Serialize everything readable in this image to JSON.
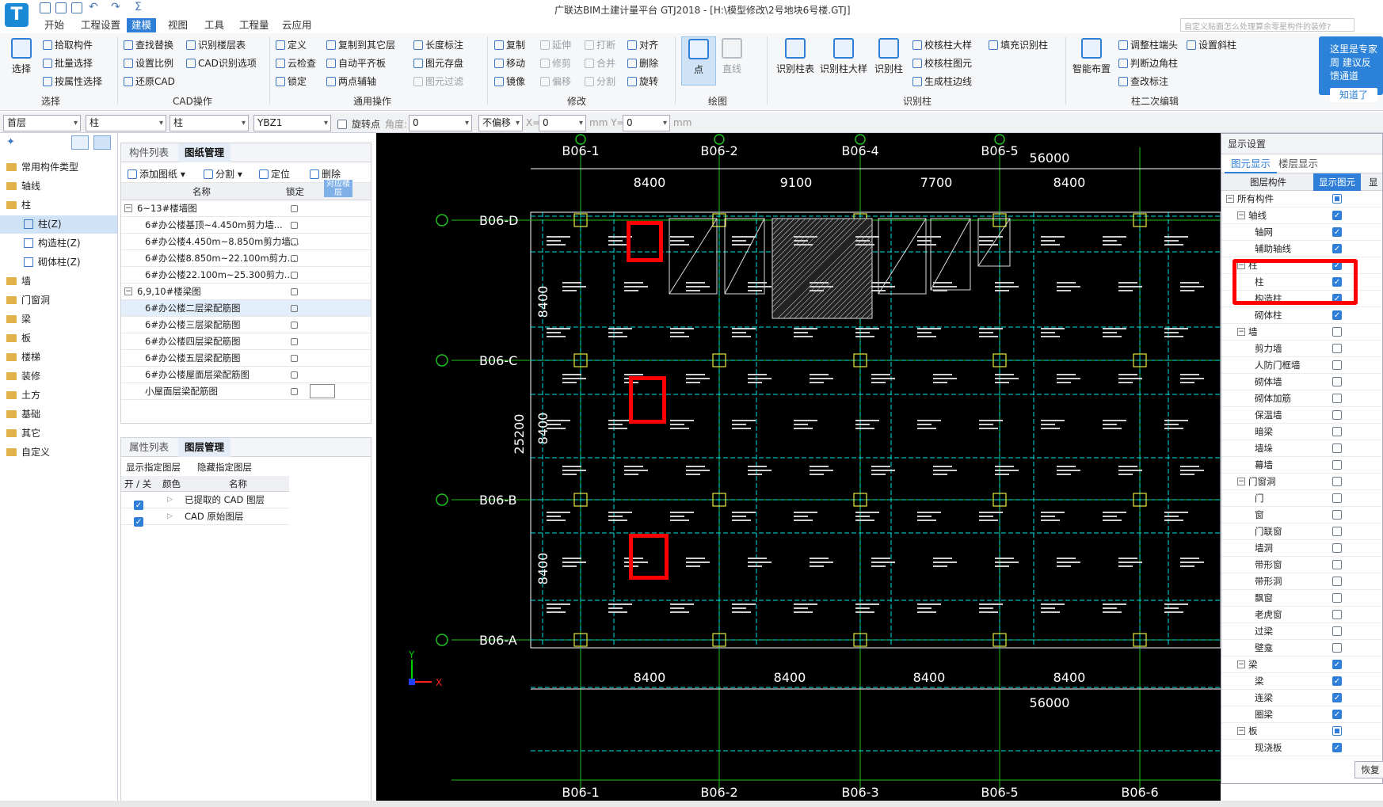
{
  "app": {
    "title": "广联达BIM土建计量平台 GTJ2018 - [H:\\模型修改\\2号地块6号楼.GTJ]",
    "logo": "T"
  },
  "menus": [
    "开始",
    "工程设置",
    "建模",
    "视图",
    "工具",
    "工程量",
    "云应用"
  ],
  "active_menu": "建模",
  "search_placeholder": "自定义贴面怎么处理算余零星构件的装修?",
  "ribbon": {
    "select": {
      "big": "选择",
      "items": [
        "拾取构件",
        "批量选择",
        "按属性选择"
      ],
      "group": "选择"
    },
    "cad": {
      "items": [
        "查找替换",
        "识别楼层表",
        "设置比例",
        "CAD识别选项",
        "还原CAD"
      ],
      "group": "CAD操作"
    },
    "general": {
      "items": [
        "定义",
        "复制到其它层",
        "长度标注",
        "云检查",
        "自动平齐板",
        "图元存盘",
        "锁定",
        "两点辅轴",
        "图元过滤"
      ],
      "group": "通用操作"
    },
    "modify": {
      "items": [
        "复制",
        "延伸",
        "打断",
        "对齐",
        "移动",
        "修剪",
        "合并",
        "删除",
        "镜像",
        "偏移",
        "分割",
        "旋转"
      ],
      "group": "修改"
    },
    "draw": {
      "big": "点",
      "line": "直线",
      "group": "绘图"
    },
    "recog": {
      "bigs": [
        "识别柱表",
        "识别柱大样",
        "识别柱"
      ],
      "items": [
        "校核柱大样",
        "填充识别柱",
        "校核柱图元",
        "生成柱边线"
      ],
      "group": "识别柱"
    },
    "edit2": {
      "big": "智能布置",
      "items": [
        "调整柱端头",
        "设置斜柱",
        "判断边角柱",
        "查改标注"
      ],
      "group": "柱二次编辑"
    }
  },
  "tip": {
    "text": "这里是专家周 建议反馈通道",
    "button": "知道了"
  },
  "propbar": {
    "floor": "首层",
    "type1": "柱",
    "type2": "柱",
    "name": "YBZ1",
    "rotate_label": "旋转点",
    "angle_label": "角度:",
    "angle": "0",
    "offset": "不偏移",
    "x_label": "X=",
    "x": "0",
    "y_label": "mm Y=",
    "y": "0",
    "unit": "mm"
  },
  "nav": [
    "常用构件类型",
    "轴线",
    "柱",
    "柱(Z)",
    "构造柱(Z)",
    "砌体柱(Z)",
    "墙",
    "门窗洞",
    "梁",
    "板",
    "楼梯",
    "装修",
    "土方",
    "基础",
    "其它",
    "自定义"
  ],
  "complist": {
    "tabs": [
      "构件列表",
      "图纸管理"
    ],
    "toolbar": [
      "添加图纸",
      "分割",
      "定位",
      "删除"
    ],
    "cols": [
      "名称",
      "锁定",
      "对应楼层"
    ],
    "rows": [
      "6~13#楼墙图",
      "6#办公楼基顶~4.450m剪力墙...",
      "6#办公楼4.450m~8.850m剪力墙...",
      "6#办公楼8.850m~22.100m剪力...",
      "6#办公楼22.100m~25.300剪力...",
      "6,9,10#楼梁图",
      "6#办公楼二层梁配筋图",
      "6#办公楼三层梁配筋图",
      "6#办公楼四层梁配筋图",
      "6#办公楼五层梁配筋图",
      "6#办公楼屋面层梁配筋图",
      "小屋面层梁配筋图"
    ]
  },
  "layermgr": {
    "tabs": [
      "属性列表",
      "图层管理"
    ],
    "actions": [
      "显示指定图层",
      "隐藏指定图层"
    ],
    "cols": [
      "开 / 关",
      "颜色",
      "名称"
    ],
    "rows": [
      "已提取的 CAD 图层",
      "CAD 原始图层"
    ]
  },
  "canvas": {
    "top_axes": [
      "B06-1",
      "B06-2",
      "B06-4",
      "B06-5"
    ],
    "bottom_axes": [
      "B06-1",
      "B06-2",
      "B06-3",
      "B06-5",
      "B06-6"
    ],
    "left_axes": [
      "B06-D",
      "B06-C",
      "B06-B",
      "B06-A"
    ],
    "top_dims": [
      "8400",
      "9100",
      "7700",
      "8400"
    ],
    "bottom_dims": [
      "8400",
      "8400",
      "8400",
      "8400"
    ],
    "overall": "56000",
    "vdims": [
      "8400",
      "8400",
      "8400"
    ],
    "vtotal": "25200",
    "x_label": "X",
    "y_label": "Y"
  },
  "display": {
    "title": "显示设置",
    "tabs": [
      "图元显示",
      "楼层显示"
    ],
    "cols": [
      "图层构件",
      "显示图元",
      "显"
    ],
    "rows": [
      [
        "所有构件",
        0,
        "partial"
      ],
      [
        "轴线",
        1,
        "on"
      ],
      [
        "轴网",
        2,
        "on"
      ],
      [
        "辅助轴线",
        2,
        "on"
      ],
      [
        "柱",
        1,
        "on"
      ],
      [
        "柱",
        2,
        "on"
      ],
      [
        "构造柱",
        2,
        "on"
      ],
      [
        "砌体柱",
        2,
        "on"
      ],
      [
        "墙",
        1,
        "off"
      ],
      [
        "剪力墙",
        2,
        "off"
      ],
      [
        "人防门框墙",
        2,
        "off"
      ],
      [
        "砌体墙",
        2,
        "off"
      ],
      [
        "砌体加筋",
        2,
        "off"
      ],
      [
        "保温墙",
        2,
        "off"
      ],
      [
        "暗梁",
        2,
        "off"
      ],
      [
        "墙垛",
        2,
        "off"
      ],
      [
        "幕墙",
        2,
        "off"
      ],
      [
        "门窗洞",
        1,
        "off"
      ],
      [
        "门",
        2,
        "off"
      ],
      [
        "窗",
        2,
        "off"
      ],
      [
        "门联窗",
        2,
        "off"
      ],
      [
        "墙洞",
        2,
        "off"
      ],
      [
        "带形窗",
        2,
        "off"
      ],
      [
        "带形洞",
        2,
        "off"
      ],
      [
        "飘窗",
        2,
        "off"
      ],
      [
        "老虎窗",
        2,
        "off"
      ],
      [
        "过梁",
        2,
        "off"
      ],
      [
        "壁龛",
        2,
        "off"
      ],
      [
        "梁",
        1,
        "on"
      ],
      [
        "梁",
        2,
        "on"
      ],
      [
        "连梁",
        2,
        "on"
      ],
      [
        "圈梁",
        2,
        "on"
      ],
      [
        "板",
        1,
        "partial"
      ],
      [
        "现浇板",
        2,
        "on"
      ]
    ],
    "restore": "恢复"
  },
  "colors": {
    "accent": "#2f7fd8",
    "highlight": "#ff0000",
    "grid": "#00e5e5",
    "axis": "#20c020"
  }
}
